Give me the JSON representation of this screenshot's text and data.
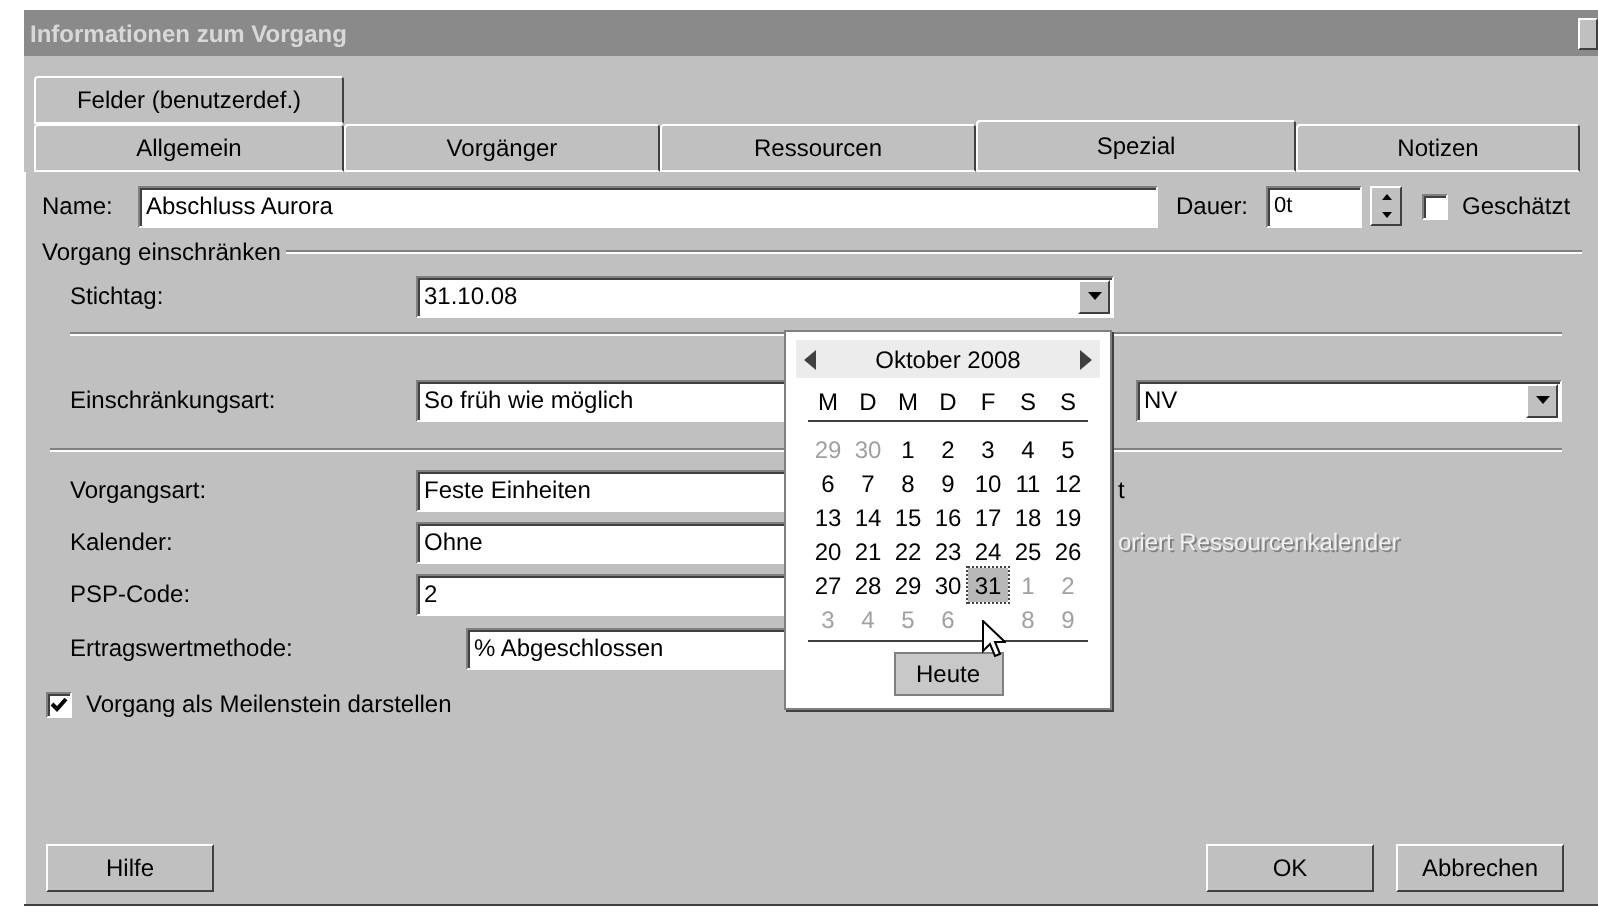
{
  "window": {
    "title": "Informationen zum Vorgang"
  },
  "tab_rows": [
    {
      "tabs": [
        {
          "label": "Felder (benutzerdef.)",
          "selected": false
        }
      ]
    },
    {
      "tabs": [
        {
          "label": "Allgemein",
          "selected": false
        },
        {
          "label": "Vorgänger",
          "selected": false
        },
        {
          "label": "Ressourcen",
          "selected": false
        },
        {
          "label": "Spezial",
          "selected": true
        },
        {
          "label": "Notizen",
          "selected": false
        }
      ]
    }
  ],
  "name_field": {
    "label": "Name:",
    "value": "Abschluss Aurora"
  },
  "duration": {
    "label": "Dauer:",
    "value": "0t"
  },
  "estimated": {
    "label": "Geschätzt",
    "checked": false
  },
  "constraint_group": {
    "title": "Vorgang einschränken"
  },
  "deadline": {
    "label": "Stichtag:",
    "value": "31.10.08"
  },
  "constraint_type": {
    "label": "Einschränkungsart:",
    "value": "So früh wie möglich"
  },
  "constraint_date": {
    "value": "NV"
  },
  "fields": [
    {
      "label": "Vorgangsart:",
      "value": "Feste Einheiten",
      "trailing": {
        "text": "t",
        "disabled": false
      }
    },
    {
      "label": "Kalender:",
      "value": "Ohne",
      "trailing": {
        "text": "oriert Ressourcenkalender",
        "disabled": true
      }
    },
    {
      "label": "PSP-Code:",
      "value": "2"
    },
    {
      "label": "Ertragswertmethode:",
      "value": "% Abgeschlossen"
    }
  ],
  "milestone": {
    "label": "Vorgang als Meilenstein darstellen",
    "checked": true
  },
  "date_picker": {
    "month": "Oktober 2008",
    "weekdays": [
      "M",
      "D",
      "M",
      "D",
      "F",
      "S",
      "S"
    ],
    "days": [
      {
        "day": "29",
        "other_month": true,
        "selected": false
      },
      {
        "day": "30",
        "other_month": true,
        "selected": false
      },
      {
        "day": "1",
        "other_month": false,
        "selected": false
      },
      {
        "day": "2",
        "other_month": false,
        "selected": false
      },
      {
        "day": "3",
        "other_month": false,
        "selected": false
      },
      {
        "day": "4",
        "other_month": false,
        "selected": false
      },
      {
        "day": "5",
        "other_month": false,
        "selected": false
      },
      {
        "day": "6",
        "other_month": false,
        "selected": false
      },
      {
        "day": "7",
        "other_month": false,
        "selected": false
      },
      {
        "day": "8",
        "other_month": false,
        "selected": false
      },
      {
        "day": "9",
        "other_month": false,
        "selected": false
      },
      {
        "day": "10",
        "other_month": false,
        "selected": false
      },
      {
        "day": "11",
        "other_month": false,
        "selected": false
      },
      {
        "day": "12",
        "other_month": false,
        "selected": false
      },
      {
        "day": "13",
        "other_month": false,
        "selected": false
      },
      {
        "day": "14",
        "other_month": false,
        "selected": false
      },
      {
        "day": "15",
        "other_month": false,
        "selected": false
      },
      {
        "day": "16",
        "other_month": false,
        "selected": false
      },
      {
        "day": "17",
        "other_month": false,
        "selected": false
      },
      {
        "day": "18",
        "other_month": false,
        "selected": false
      },
      {
        "day": "19",
        "other_month": false,
        "selected": false
      },
      {
        "day": "20",
        "other_month": false,
        "selected": false
      },
      {
        "day": "21",
        "other_month": false,
        "selected": false
      },
      {
        "day": "22",
        "other_month": false,
        "selected": false
      },
      {
        "day": "23",
        "other_month": false,
        "selected": false
      },
      {
        "day": "24",
        "other_month": false,
        "selected": false
      },
      {
        "day": "25",
        "other_month": false,
        "selected": false
      },
      {
        "day": "26",
        "other_month": false,
        "selected": false
      },
      {
        "day": "27",
        "other_month": false,
        "selected": false
      },
      {
        "day": "28",
        "other_month": false,
        "selected": false
      },
      {
        "day": "29",
        "other_month": false,
        "selected": false
      },
      {
        "day": "30",
        "other_month": false,
        "selected": false
      },
      {
        "day": "31",
        "other_month": false,
        "selected": true
      },
      {
        "day": "1",
        "other_month": true,
        "selected": false
      },
      {
        "day": "2",
        "other_month": true,
        "selected": false
      },
      {
        "day": "3",
        "other_month": true,
        "selected": false
      },
      {
        "day": "4",
        "other_month": true,
        "selected": false
      },
      {
        "day": "5",
        "other_month": true,
        "selected": false
      },
      {
        "day": "6",
        "other_month": true,
        "selected": false
      },
      {
        "day": "8",
        "other_month": true,
        "selected": false
      },
      {
        "day": "9",
        "other_month": true,
        "selected": false
      }
    ],
    "today_button": "Heute"
  },
  "buttons": [
    {
      "label": "Hilfe",
      "kind": "left"
    },
    {
      "label": "OK",
      "kind": "right"
    },
    {
      "label": "Abbrechen",
      "kind": "right"
    }
  ]
}
